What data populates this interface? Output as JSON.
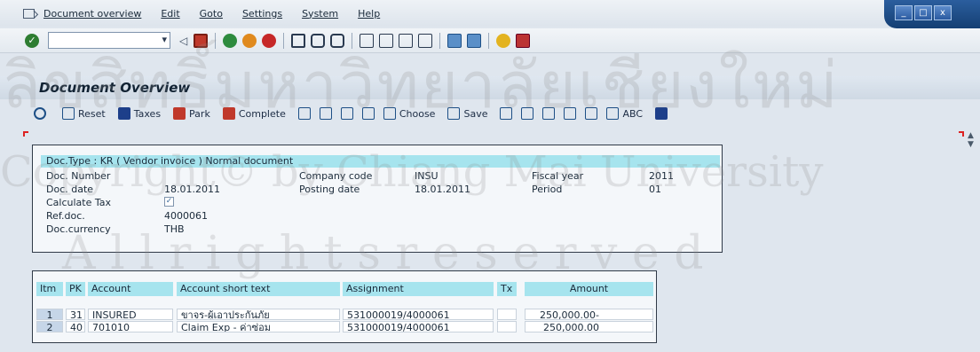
{
  "menu": {
    "items": [
      "Document overview",
      "Edit",
      "Goto",
      "Settings",
      "System",
      "Help"
    ],
    "window_controls": [
      "_",
      "□",
      "x"
    ]
  },
  "title": "Document Overview",
  "app_toolbar": {
    "reset": "Reset",
    "taxes": "Taxes",
    "park": "Park",
    "complete": "Complete",
    "choose": "Choose",
    "save": "Save",
    "abc": "ABC"
  },
  "header": {
    "doc_type": "Doc.Type : KR ( Vendor invoice ) Normal document",
    "labels": {
      "doc_number": "Doc. Number",
      "doc_date": "Doc. date",
      "calculate_tax": "Calculate Tax",
      "ref_doc": "Ref.doc.",
      "doc_currency": "Doc.currency",
      "company_code": "Company code",
      "posting_date": "Posting date",
      "fiscal_year": "Fiscal year",
      "period": "Period"
    },
    "values": {
      "doc_number": "",
      "doc_date": "18.01.2011",
      "calculate_tax": "✓",
      "ref_doc": "4000061",
      "doc_currency": "THB",
      "company_code": "INSU",
      "posting_date": "18.01.2011",
      "fiscal_year": "2011",
      "period": "01"
    }
  },
  "items": {
    "columns": {
      "itm": "Itm",
      "pk": "PK",
      "account": "Account",
      "short_text": "Account short text",
      "assignment": "Assignment",
      "tx": "Tx",
      "amount": "Amount"
    },
    "rows": [
      {
        "itm": "1",
        "pk": "31",
        "account": "INSURED",
        "short_text": "ขาจร-ผู้เอาประกันภัย",
        "assignment": "531000019/4000061",
        "tx": "",
        "amount": "250,000.00-"
      },
      {
        "itm": "2",
        "pk": "40",
        "account": "701010",
        "short_text": "Claim Exp - ค่าซ่อม",
        "assignment": "531000019/4000061",
        "tx": "",
        "amount": "250,000.00"
      }
    ]
  },
  "watermark": {
    "line1": "ลิขสิทธิ์มหาวิทยาลัยเชียงใหม่",
    "line2": "Copyright© by Chiang Mai University",
    "line3": "A l l   r i g h t s   r e s e r v e d"
  }
}
